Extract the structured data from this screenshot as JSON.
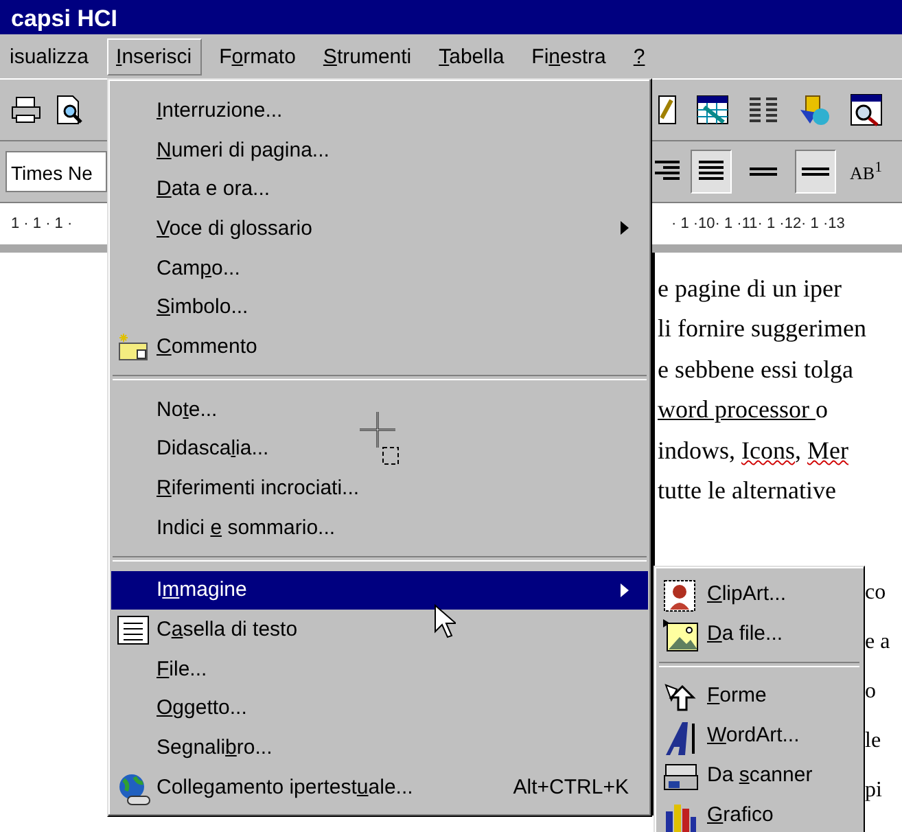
{
  "window": {
    "title": "capsi HCI"
  },
  "menu_bar": [
    {
      "post": "isualizza",
      "selected": false
    },
    {
      "key": "I",
      "post": "nserisci",
      "selected": true
    },
    {
      "pre": "F",
      "key": "o",
      "post": "rmato",
      "selected": false
    },
    {
      "key": "S",
      "post": "trumenti",
      "selected": false
    },
    {
      "key": "T",
      "post": "abella",
      "selected": false
    },
    {
      "pre": "Fi",
      "key": "n",
      "post": "estra",
      "selected": false
    },
    {
      "key": "?",
      "selected": false
    }
  ],
  "toolbar_left": {
    "font_field": "Times Ne",
    "ruler": "1 · 1 · 1 ·"
  },
  "toolbar_right": {
    "superscript_button": "AB$^{1}$",
    "ruler": "· 1 ·10· 1 ·11· 1 ·12· 1 ·13"
  },
  "document_lines": [
    {
      "kind": "full",
      "text": "e pagine di un iper"
    },
    {
      "kind": "full",
      "text": "li fornire suggerimen"
    },
    {
      "kind": "full",
      "text": "e sebbene essi tolga"
    },
    {
      "kind": "link",
      "text": "word processor ",
      "after": "o"
    },
    {
      "kind": "squiggle",
      "text": "indows, ",
      "marked": "Icons",
      "after": ", ",
      "marked2": "Mer"
    },
    {
      "kind": "full",
      "text": "tutte le alternative"
    },
    {
      "kind": "beside",
      "text": "co"
    },
    {
      "kind": "beside",
      "text": "e a"
    },
    {
      "kind": "beside",
      "text": "o"
    },
    {
      "kind": "beside",
      "text": "le"
    },
    {
      "kind": "beside",
      "text": "pi"
    }
  ],
  "insert_menu": [
    {
      "kind": "item",
      "key": "I",
      "post": "nterruzione...",
      "selected": false
    },
    {
      "kind": "item",
      "key": "N",
      "post": "umeri di pagina...",
      "selected": false
    },
    {
      "kind": "item",
      "key": "D",
      "post": "ata e ora...",
      "selected": false
    },
    {
      "kind": "submenu",
      "key": "V",
      "post": "oce di glossario",
      "selected": false
    },
    {
      "kind": "item",
      "pre": "Cam",
      "key": "p",
      "post": "o...",
      "selected": false
    },
    {
      "kind": "item",
      "key": "S",
      "post": "imbolo...",
      "selected": false
    },
    {
      "kind": "item",
      "key": "C",
      "post": "ommento",
      "selected": false
    },
    {
      "kind": "separator"
    },
    {
      "kind": "item",
      "pre": "No",
      "key": "t",
      "post": "e...",
      "selected": false
    },
    {
      "kind": "item",
      "pre": "Didasca",
      "key": "l",
      "post": "ia...",
      "selected": false
    },
    {
      "kind": "item",
      "key": "R",
      "post": "iferimenti incrociati...",
      "selected": false
    },
    {
      "kind": "item",
      "pre": "Indici ",
      "key": "e",
      "post": " sommario...",
      "selected": false
    },
    {
      "kind": "separator"
    },
    {
      "kind": "submenu",
      "pre": "I",
      "key": "m",
      "post": "magine",
      "selected": true
    },
    {
      "kind": "item",
      "pre": "C",
      "key": "a",
      "post": "sella di testo",
      "selected": false
    },
    {
      "kind": "item",
      "key": "F",
      "post": "ile...",
      "selected": false
    },
    {
      "kind": "item",
      "key": "O",
      "post": "ggetto...",
      "selected": false
    },
    {
      "kind": "item",
      "pre": "Segnali",
      "key": "b",
      "post": "ro...",
      "selected": false
    },
    {
      "kind": "item",
      "pre": "Collegamento ipertest",
      "key": "u",
      "post": "ale...",
      "shortcut": "Alt+CTRL+K",
      "selected": false
    }
  ],
  "image_submenu": [
    {
      "kind": "item",
      "key": "C",
      "post": "lipArt..."
    },
    {
      "kind": "item",
      "key": "D",
      "post": "a file..."
    },
    {
      "kind": "separator"
    },
    {
      "kind": "item",
      "key": "F",
      "post": "orme"
    },
    {
      "kind": "item",
      "key": "W",
      "post": "ordArt..."
    },
    {
      "kind": "item",
      "pre": "Da ",
      "key": "s",
      "post": "canner"
    },
    {
      "kind": "item",
      "key": "G",
      "post": "rafico"
    }
  ]
}
